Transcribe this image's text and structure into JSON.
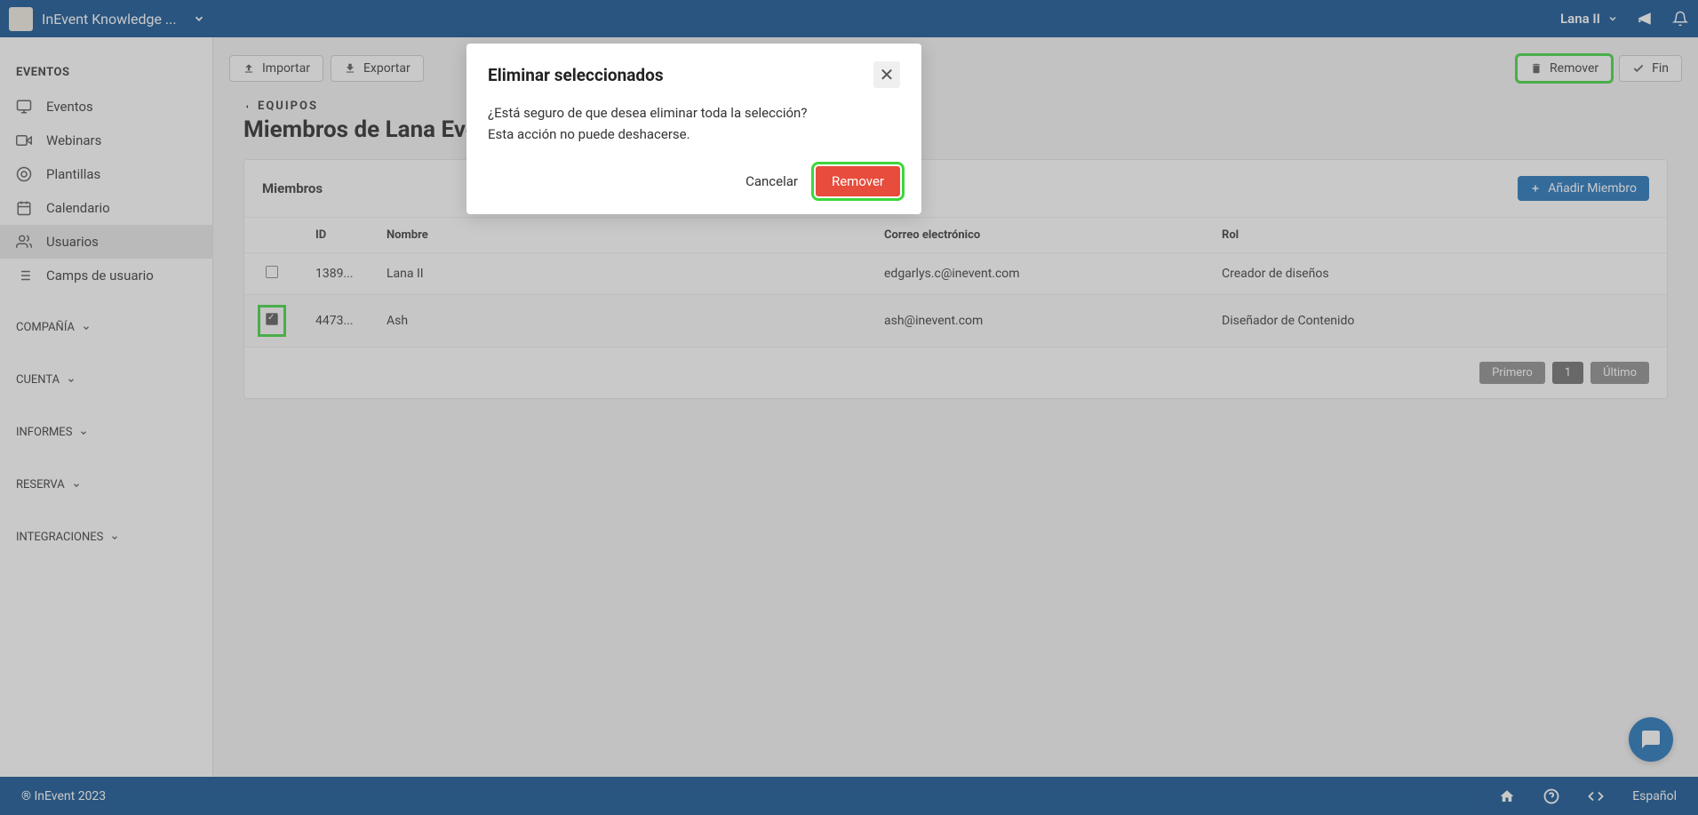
{
  "topbar": {
    "app_name": "InEvent Knowledge ...",
    "user_name": "Lana II"
  },
  "sidebar": {
    "heading": "EVENTOS",
    "items": [
      {
        "label": "Eventos",
        "icon": "monitor"
      },
      {
        "label": "Webinars",
        "icon": "camera"
      },
      {
        "label": "Plantillas",
        "icon": "template"
      },
      {
        "label": "Calendario",
        "icon": "calendar"
      },
      {
        "label": "Usuarios",
        "icon": "users",
        "active": true
      },
      {
        "label": "Camps de usuario",
        "icon": "list"
      }
    ],
    "groups": [
      {
        "label": "COMPAÑÍA"
      },
      {
        "label": "CUENTA"
      },
      {
        "label": "INFORMES"
      },
      {
        "label": "RESERVA"
      },
      {
        "label": "INTEGRACIONES"
      }
    ]
  },
  "actions": {
    "import": "Importar",
    "export": "Exportar",
    "remove": "Remover",
    "finish": "Fin"
  },
  "breadcrumb": "EQUIPOS",
  "page_title": "Miembros de Lana Evento",
  "card": {
    "title": "Miembros",
    "add_member": "Añadir Miembro"
  },
  "table": {
    "headers": {
      "id": "ID",
      "name": "Nombre",
      "email": "Correo electrónico",
      "role": "Rol"
    },
    "rows": [
      {
        "checked": false,
        "id": "1389...",
        "name": "Lana II",
        "email": "edgarlys.c@inevent.com",
        "role": "Creador de diseños"
      },
      {
        "checked": true,
        "id": "4473...",
        "name": "Ash",
        "email": "ash@inevent.com",
        "role": "Diseñador de Contenido"
      }
    ]
  },
  "pagination": {
    "first": "Primero",
    "page": "1",
    "last": "Último"
  },
  "modal": {
    "title": "Eliminar seleccionados",
    "line1": "¿Está seguro de que desea eliminar toda la selección?",
    "line2": "Esta acción no puede deshacerse.",
    "cancel": "Cancelar",
    "remove": "Remover"
  },
  "footer": {
    "copyright": "® InEvent 2023",
    "language": "Español"
  }
}
